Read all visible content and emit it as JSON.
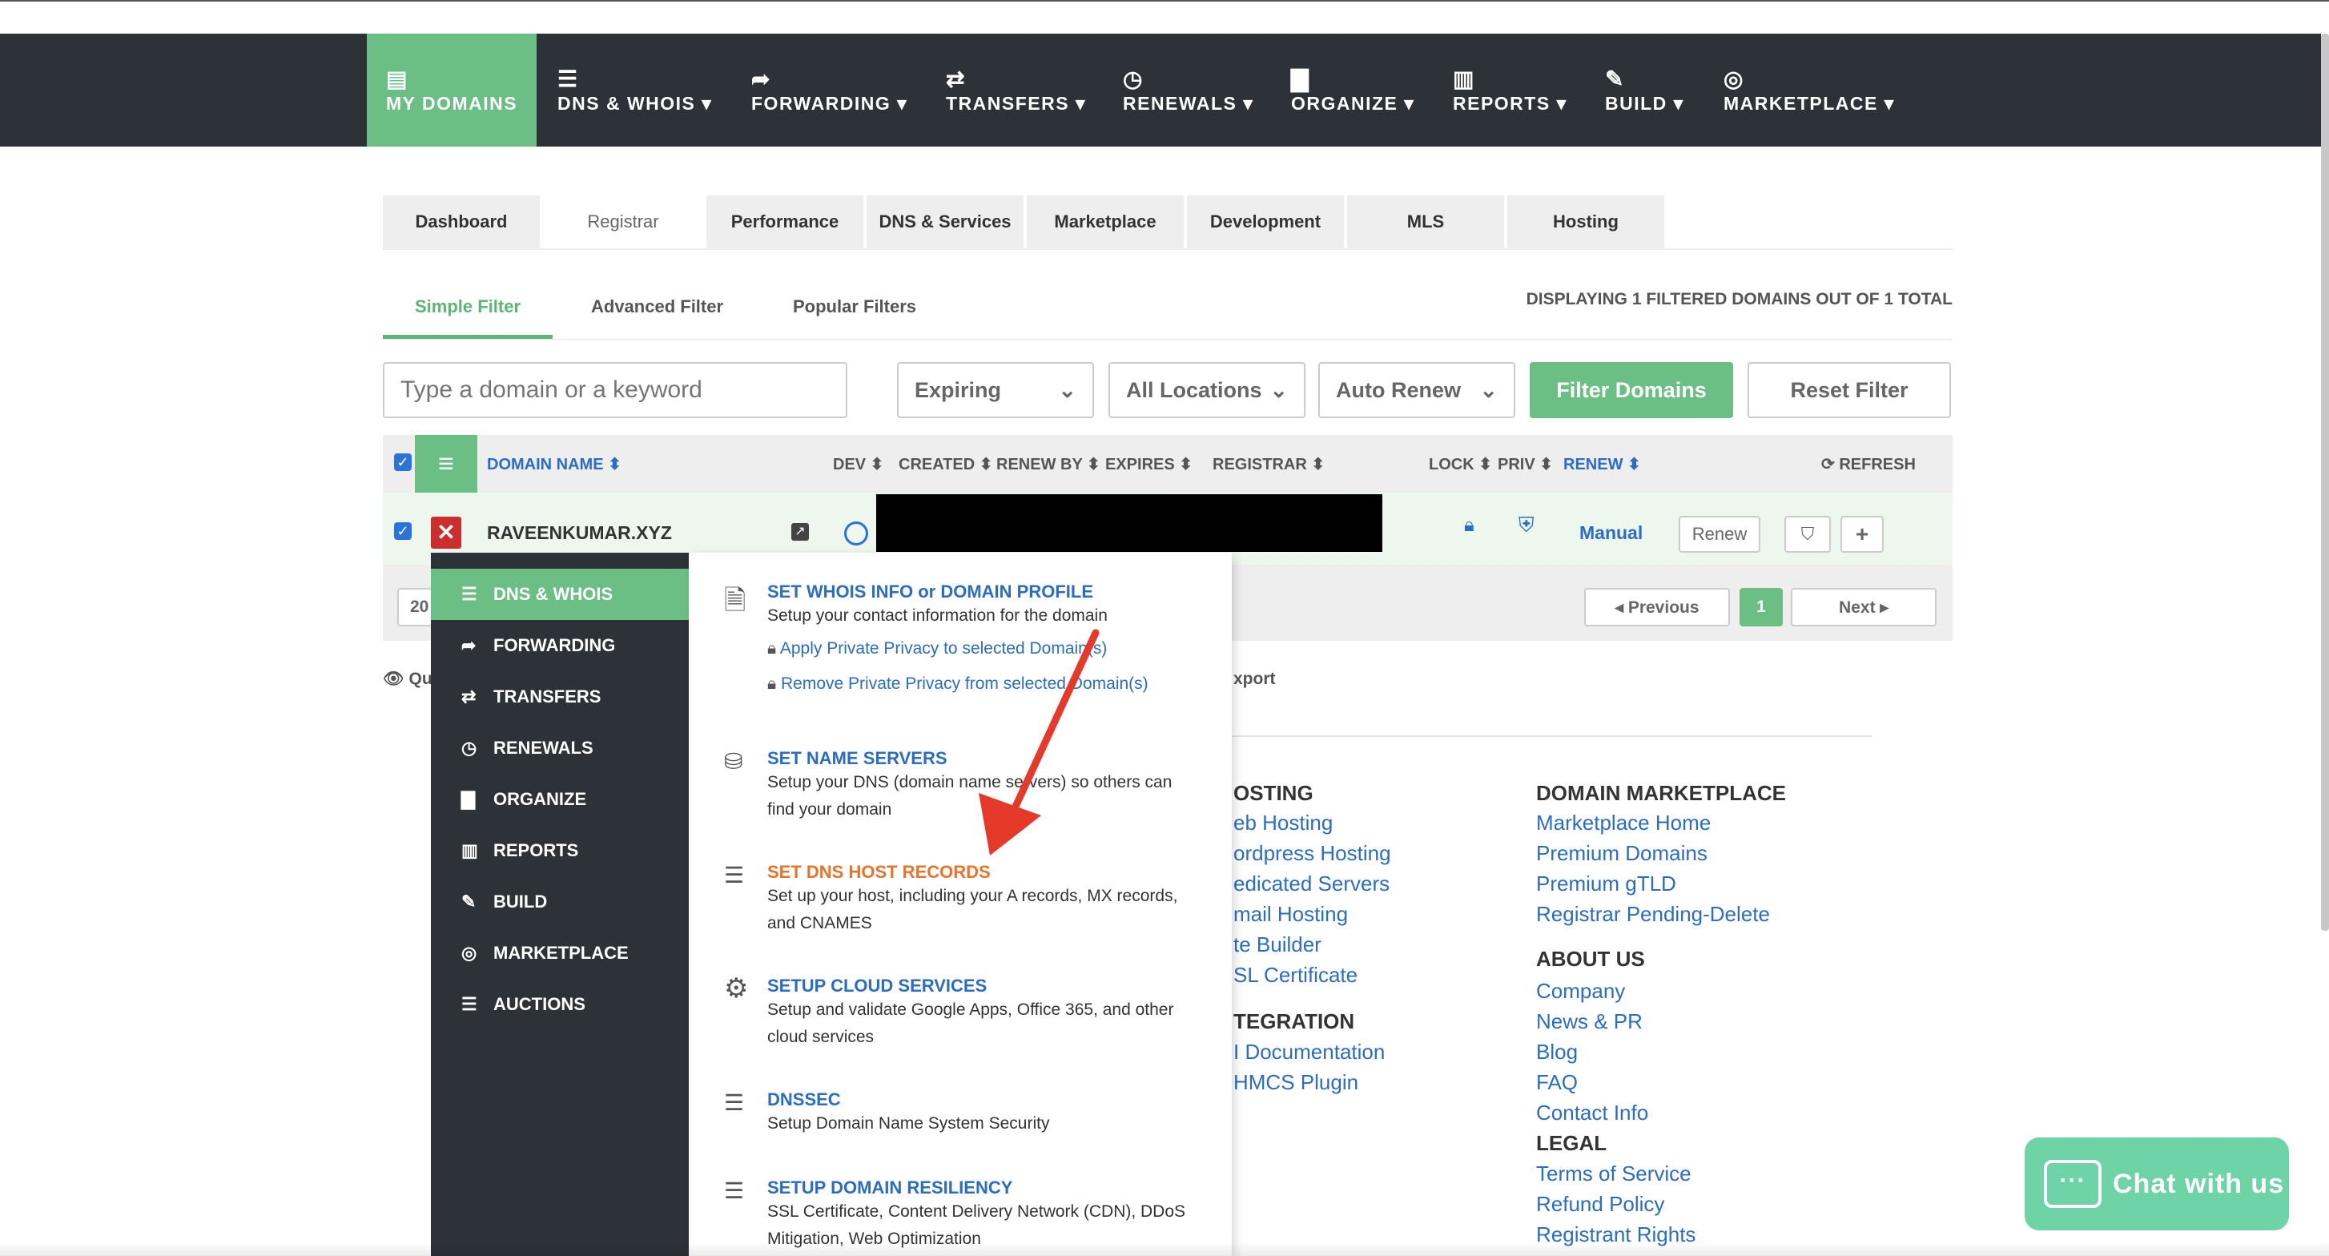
{
  "nav": {
    "items": [
      {
        "label": "MY DOMAINS",
        "icon": "list-icon",
        "glyph": "▤"
      },
      {
        "label": "DNS & WHOIS ▾",
        "icon": "server-icon",
        "glyph": "☰"
      },
      {
        "label": "FORWARDING ▾",
        "icon": "share-icon",
        "glyph": "➦"
      },
      {
        "label": "TRANSFERS ▾",
        "icon": "exchange-icon",
        "glyph": "⇄"
      },
      {
        "label": "RENEWALS ▾",
        "icon": "clock-icon",
        "glyph": "◷"
      },
      {
        "label": "ORGANIZE ▾",
        "icon": "briefcase-icon",
        "glyph": "▇"
      },
      {
        "label": "REPORTS ▾",
        "icon": "bar-chart-icon",
        "glyph": "▥"
      },
      {
        "label": "BUILD ▾",
        "icon": "wrench-icon",
        "glyph": "✎"
      },
      {
        "label": "MARKETPLACE ▾",
        "icon": "target-icon",
        "glyph": "◎"
      }
    ]
  },
  "tabs": [
    "Dashboard",
    "Registrar",
    "Performance",
    "DNS & Services",
    "Marketplace",
    "Development",
    "MLS",
    "Hosting"
  ],
  "filters": {
    "simple": "Simple Filter",
    "advanced": "Advanced Filter",
    "popular": "Popular Filters",
    "display_count": "DISPLAYING 1 FILTERED DOMAINS OUT OF 1 TOTAL",
    "search_placeholder": "Type a domain or a keyword",
    "expiring": "Expiring",
    "locations": "All Locations",
    "auto_renew": "Auto Renew",
    "filter_button": "Filter Domains",
    "reset_button": "Reset Filter"
  },
  "table": {
    "headers": {
      "domain_name": "DOMAIN NAME ⬍",
      "dev": "DEV ⬍",
      "created": "CREATED ⬍",
      "renew_by": "RENEW BY ⬍",
      "expires": "EXPIRES ⬍",
      "registrar": "REGISTRAR ⬍",
      "lock": "LOCK ⬍",
      "priv": "PRIV ⬍",
      "renew": "RENEW ⬍",
      "refresh": "⟳ REFRESH"
    },
    "row": {
      "domain": "RAVEENKUMAR.XYZ",
      "renew_mode": "Manual",
      "renew_button": "Renew",
      "add_button": "+"
    },
    "per_page": "20",
    "pager": {
      "previous": "◂ Previous",
      "current": "1",
      "next": "Next ▸"
    }
  },
  "sidemenu": {
    "items": [
      {
        "label": "DNS & WHOIS",
        "icon": "server-icon",
        "glyph": "☰"
      },
      {
        "label": "FORWARDING",
        "icon": "share-icon",
        "glyph": "➦"
      },
      {
        "label": "TRANSFERS",
        "icon": "exchange-icon",
        "glyph": "⇄"
      },
      {
        "label": "RENEWALS",
        "icon": "clock-icon",
        "glyph": "◷"
      },
      {
        "label": "ORGANIZE",
        "icon": "briefcase-icon",
        "glyph": "▇"
      },
      {
        "label": "REPORTS",
        "icon": "bar-chart-icon",
        "glyph": "▥"
      },
      {
        "label": "BUILD",
        "icon": "wrench-icon",
        "glyph": "✎"
      },
      {
        "label": "MARKETPLACE",
        "icon": "target-icon",
        "glyph": "◎"
      },
      {
        "label": "AUCTIONS",
        "icon": "list-icon",
        "glyph": "☰"
      }
    ]
  },
  "popup": {
    "whois": {
      "title": "SET WHOIS INFO or DOMAIN PROFILE",
      "desc": "Setup your contact information for the domain",
      "link1": "Apply Private Privacy to selected Domain(s)",
      "link2": "Remove Private Privacy from selected Domain(s)"
    },
    "nameservers": {
      "title": "SET NAME SERVERS",
      "desc": "Setup your DNS (domain name servers) so others can find your domain"
    },
    "hostrecords": {
      "title": "SET DNS HOST RECORDS",
      "desc": "Set up your host, including your A records, MX records, and CNAMES"
    },
    "cloud": {
      "title": "SETUP CLOUD SERVICES",
      "desc": "Setup and validate Google Apps, Office 365, and other cloud services"
    },
    "dnssec": {
      "title": "DNSSEC",
      "desc": "Setup Domain Name System Security"
    },
    "resiliency": {
      "title": "SETUP DOMAIN RESILIENCY",
      "desc": "SSL Certificate, Content Delivery Network (CDN), DDoS Mitigation, Web Optimization"
    }
  },
  "below": {
    "quick": "Qu",
    "export": "xport"
  },
  "footer": {
    "hosting_title": "OSTING",
    "hosting_links": [
      "eb Hosting",
      "ordpress Hosting",
      "edicated Servers",
      "mail Hosting",
      "te Builder",
      "SL Certificate"
    ],
    "integration_title": "TEGRATION",
    "integration_links": [
      "I Documentation",
      "HMCS Plugin"
    ],
    "marketplace_title": "DOMAIN MARKETPLACE",
    "marketplace_links": [
      "Marketplace Home",
      "Premium Domains",
      "Premium gTLD",
      "Registrar Pending-Delete"
    ],
    "about_title": "ABOUT US",
    "about_links": [
      "Company",
      "News & PR",
      "Blog",
      "FAQ",
      "Contact Info"
    ],
    "legal_title": "LEGAL",
    "legal_links": [
      "Terms of Service",
      "Refund Policy",
      "Registrant Rights"
    ]
  },
  "chat": {
    "label": "Chat with us"
  },
  "colors": {
    "nav_bg": "#2d3238",
    "accent_green": "#6cbf84",
    "link_blue": "#2b6cc4",
    "highlight_orange": "#e8732a",
    "arrow_red": "#e53a2a"
  }
}
